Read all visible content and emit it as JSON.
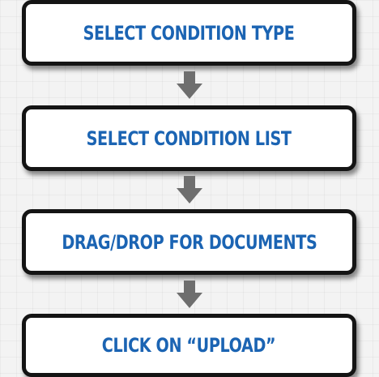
{
  "steps": [
    {
      "label": "Select Condition Type"
    },
    {
      "label": "Select Condition List"
    },
    {
      "label": "Drag/Drop for Documents"
    },
    {
      "label": "Click on “Upload”"
    }
  ],
  "colors": {
    "label": "#1b64b3",
    "box_border": "#141414",
    "box_fill": "#ffffff",
    "arrow": "#6e6e6e",
    "background": "#f3f3f3"
  },
  "icons": {
    "connector": "down-arrow-icon"
  }
}
